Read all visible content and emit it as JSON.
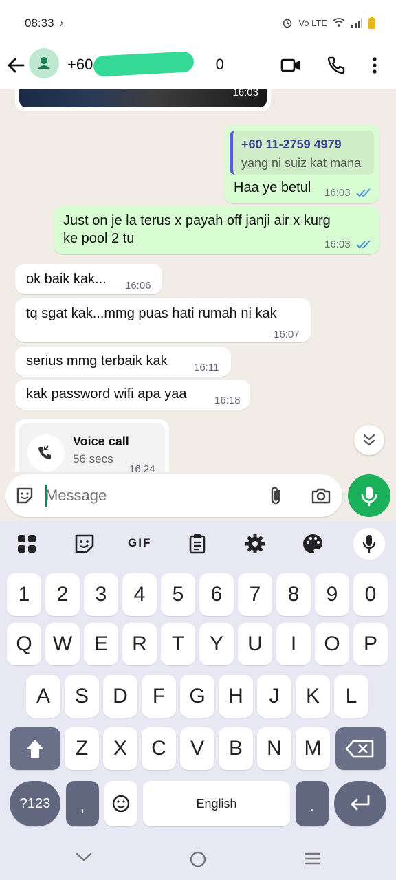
{
  "status_bar": {
    "time": "08:33",
    "right_indicators": "Vo LTE"
  },
  "header": {
    "contact_name": "+60 1",
    "contact_suffix": "0"
  },
  "chat": {
    "image_timestamp": "16:03",
    "reply_bubble": {
      "quote_name": "+60 11-2759 4979",
      "quote_text": "yang ni suiz kat mana",
      "text": "Haa ye betul",
      "time": "16:03"
    },
    "out_msg_2": {
      "line1": "Just on je la terus x payah off janji air x kurg",
      "line2": "ke pool 2 tu",
      "time": "16:03"
    },
    "in_messages": [
      {
        "text": "ok baik kak...",
        "time": "16:06"
      },
      {
        "text": "tq sgat kak...mmg puas hati rumah ni kak",
        "time": "16:07"
      },
      {
        "text": "serius mmg terbaik kak",
        "time": "16:11"
      },
      {
        "text": "kak password wifi apa yaa",
        "time": "16:18"
      }
    ],
    "voice_call": {
      "title": "Voice call",
      "duration": "56 secs",
      "time": "16:24"
    }
  },
  "composer": {
    "placeholder": "Message"
  },
  "keyboard": {
    "toolbar": [
      "apps-icon",
      "sticker-icon",
      "GIF",
      "clipboard-icon",
      "settings-icon",
      "palette-icon",
      "mic-icon"
    ],
    "gif_label": "GIF",
    "row_numbers": [
      "1",
      "2",
      "3",
      "4",
      "5",
      "6",
      "7",
      "8",
      "9",
      "0"
    ],
    "row1": [
      "Q",
      "W",
      "E",
      "R",
      "T",
      "Y",
      "U",
      "I",
      "O",
      "P"
    ],
    "row2": [
      "A",
      "S",
      "D",
      "F",
      "G",
      "H",
      "J",
      "K",
      "L"
    ],
    "row3": [
      "Z",
      "X",
      "C",
      "V",
      "B",
      "N",
      "M"
    ],
    "symbols_label": "?123",
    "comma": ",",
    "space_label": "English",
    "period": "."
  },
  "colors": {
    "accent": "#1bb15a",
    "outgoing": "#d8fdd2",
    "chat_bg": "#f1ede6",
    "keyboard_bg": "#e8e7f4",
    "read_ticks": "#3b8fe4"
  }
}
